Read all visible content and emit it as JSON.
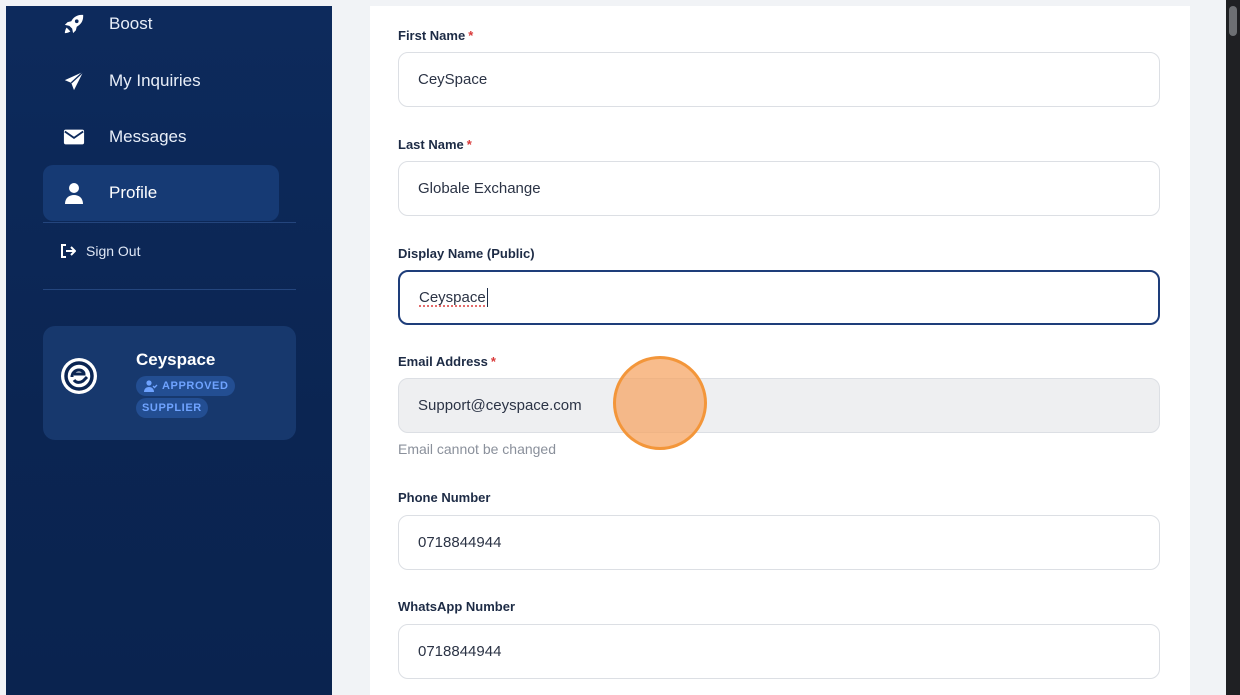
{
  "sidebar": {
    "items": [
      {
        "label": "Boost",
        "icon": "rocket-icon"
      },
      {
        "label": "My Inquiries",
        "icon": "paper-plane-icon"
      },
      {
        "label": "Messages",
        "icon": "envelope-icon"
      },
      {
        "label": "Profile",
        "icon": "user-icon",
        "active": true
      }
    ],
    "sign_out": {
      "label": "Sign Out",
      "icon": "sign-out-icon"
    }
  },
  "profile_card": {
    "name": "Ceyspace",
    "badge_line1": "APPROVED",
    "badge_line2": "SUPPLIER",
    "logo_icon": "ceyspace-logo-icon"
  },
  "form": {
    "first_name": {
      "label": "First Name",
      "value": "CeySpace",
      "required": true
    },
    "last_name": {
      "label": "Last Name",
      "value": "Globale Exchange",
      "required": true
    },
    "display_name": {
      "label": "Display Name (Public)",
      "value": "Ceyspace",
      "required": false
    },
    "email": {
      "label": "Email Address",
      "value": "Support@ceyspace.com",
      "required": true,
      "hint": "Email cannot be changed"
    },
    "phone": {
      "label": "Phone Number",
      "value": "0718844944"
    },
    "whatsapp": {
      "label": "WhatsApp Number",
      "value": "0718844944"
    },
    "required_marker": "*"
  },
  "colors": {
    "sidebar_bg": "#0d2a5c",
    "active_item": "#163a74",
    "badge_text": "#6fa3ff",
    "required": "#d93a3a",
    "focus_border": "#1e3d7a",
    "click_indicator": "#f3963a"
  }
}
